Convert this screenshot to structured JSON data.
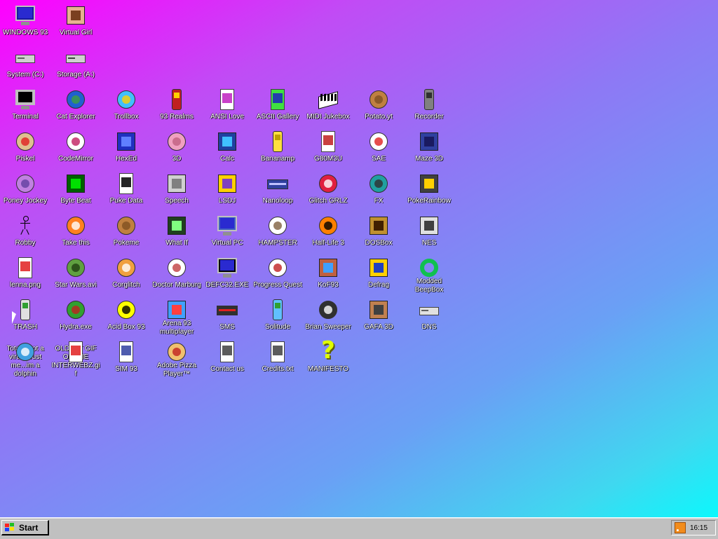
{
  "desktop": {
    "icons": [
      {
        "label": "WINDOWS 93",
        "icon": "computer-icon"
      },
      {
        "label": "Virtual Girl",
        "icon": "girl-portrait-icon"
      },
      {
        "label": "System (C:)",
        "icon": "hard-drive-icon"
      },
      {
        "label": "Storage (A:)",
        "icon": "floppy-drive-icon"
      },
      {
        "label": "Terminal",
        "icon": "terminal-icon"
      },
      {
        "label": "Cat Explorer",
        "icon": "cat-globe-icon"
      },
      {
        "label": "Trollbox",
        "icon": "chat-bubble-icon"
      },
      {
        "label": "93 Realms",
        "icon": "knight-icon"
      },
      {
        "label": "ANSI Love",
        "icon": "ansi-a-icon"
      },
      {
        "label": "ASCII Gallery",
        "icon": "ascii-123-icon"
      },
      {
        "label": "MIDI Jukebox",
        "icon": "piano-icon"
      },
      {
        "label": "Potato.yt",
        "icon": "potato-icon"
      },
      {
        "label": "Recorder",
        "icon": "microphone-icon"
      },
      {
        "label": "Piskel",
        "icon": "palette-icon"
      },
      {
        "label": "CodeMirror",
        "icon": "codemirror-icon"
      },
      {
        "label": "HexEd",
        "icon": "hex-cube-icon"
      },
      {
        "label": "3D",
        "icon": "teapot-icon"
      },
      {
        "label": "Calc",
        "icon": "calculator-icon"
      },
      {
        "label": "Bananamp",
        "icon": "banana-icon"
      },
      {
        "label": "G80M3U",
        "icon": "playlist-icon"
      },
      {
        "label": "SAE",
        "icon": "checkered-ball-icon"
      },
      {
        "label": "Maze 3D",
        "icon": "maze-icon"
      },
      {
        "label": "Poney Jockey",
        "icon": "pony-icon"
      },
      {
        "label": "Byte Beat",
        "icon": "bytebeat-icon"
      },
      {
        "label": "Puke Data",
        "icon": "pd-icon"
      },
      {
        "label": "Speech",
        "icon": "face-icon"
      },
      {
        "label": "LSDJ",
        "icon": "lsdj-icon"
      },
      {
        "label": "Nanoloop",
        "icon": "wave-icon"
      },
      {
        "label": "Glitch GRLZ",
        "icon": "lips-icon"
      },
      {
        "label": "FX",
        "icon": "atom-icon"
      },
      {
        "label": "PokeRainbow",
        "icon": "poke-trainers-icon"
      },
      {
        "label": "Robby",
        "icon": "stick-figure-icon"
      },
      {
        "label": "Take this",
        "icon": "pixel-character-icon"
      },
      {
        "label": "Pokeme",
        "icon": "pokeme-icon"
      },
      {
        "label": "What If",
        "icon": "bars-icon"
      },
      {
        "label": "Virtual PC",
        "icon": "window-icon"
      },
      {
        "label": "HAMPSTER",
        "icon": "hamster-icon"
      },
      {
        "label": "Half-Life 3",
        "icon": "lambda-icon"
      },
      {
        "label": "DOSBox",
        "icon": "dosbox-icon"
      },
      {
        "label": "NES",
        "icon": "nes-icon"
      },
      {
        "label": "lenna.png",
        "icon": "image-file-icon"
      },
      {
        "label": "Star Wars.avi",
        "icon": "yoda-icon"
      },
      {
        "label": "Corglitch",
        "icon": "corgi-icon"
      },
      {
        "label": "Doctor Marburg",
        "icon": "doctor-icon"
      },
      {
        "label": "DEFC32.EXE",
        "icon": "monitor-face-icon"
      },
      {
        "label": "Progress Quest",
        "icon": "crossed-swords-icon"
      },
      {
        "label": "KoF93",
        "icon": "fighter-portrait-icon"
      },
      {
        "label": "Defrag",
        "icon": "defrag-icon"
      },
      {
        "label": "Modded BeepBox",
        "icon": "ring-icon"
      },
      {
        "label": "TRASH",
        "icon": "recycle-bin-icon"
      },
      {
        "label": "Hydra.exe",
        "icon": "dragon-icon"
      },
      {
        "label": "Acid Box 93",
        "icon": "smiley-icon"
      },
      {
        "label": "Arena 93 multiplayer",
        "icon": "cube-icon"
      },
      {
        "label": "SMS",
        "icon": "console-icon"
      },
      {
        "label": "Solitude",
        "icon": "bottle-icon"
      },
      {
        "label": "Brian Sweeper",
        "icon": "mine-icon"
      },
      {
        "label": "GAFA 3D",
        "icon": "doomguy-icon"
      },
      {
        "label": "DNS",
        "icon": "dns-icon"
      },
      {
        "label": "Totally not a virus.Trust me...im a dolphin",
        "icon": "dolphin-icon"
      },
      {
        "label": "OLDEST GIF OF THE INTERWEBZ.gif",
        "icon": "gif-file-icon"
      },
      {
        "label": "SIM 93",
        "icon": "book-icon"
      },
      {
        "label": "Adobe Pizza Player™",
        "icon": "pizza-icon"
      },
      {
        "label": "Contact us",
        "icon": "letter-icon"
      },
      {
        "label": "Credits.txt",
        "icon": "text-file-icon"
      },
      {
        "label": "MANIFESTO",
        "icon": "question-mark-icon"
      }
    ]
  },
  "taskbar": {
    "start_label": "Start",
    "clock": "16:15"
  },
  "colors": {
    "gradient_start": "#ff00ff",
    "gradient_end": "#00ffff",
    "taskbar": "#c0c0c0"
  }
}
